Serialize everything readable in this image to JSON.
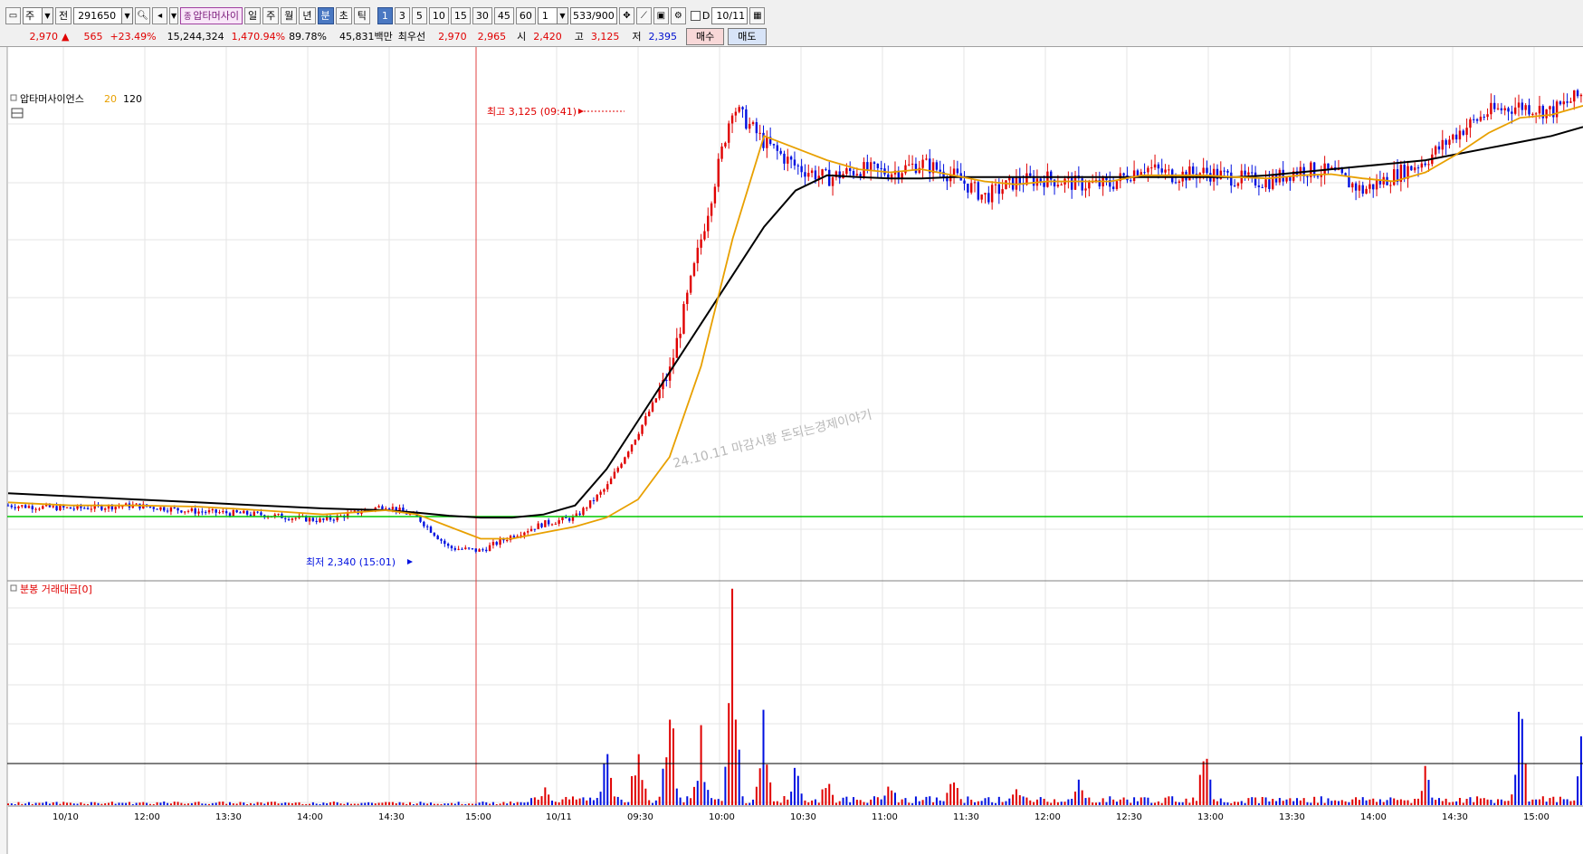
{
  "toolbar": {
    "row1": {
      "market_label": "주",
      "prefix_label": "전",
      "code": "291650",
      "stock_name": "압타머사이",
      "periods": [
        "일",
        "주",
        "월",
        "년",
        "분",
        "초",
        "틱"
      ],
      "active_period": "분",
      "intervals": [
        "1",
        "3",
        "5",
        "10",
        "15",
        "30",
        "45",
        "60"
      ],
      "active_interval": "1",
      "multiplier": "1",
      "count": "533/900",
      "d_label": "D",
      "date": "10/11"
    },
    "row2": {
      "price": "2,970",
      "change_arrow": "▲",
      "change": "565",
      "change_pct": "+23.49%",
      "volume": "15,244,324",
      "volume_ratio": "1,470.94%",
      "turnover": "89.78%",
      "amount": "45,831백만",
      "best_bid_label": "최우선",
      "best_bid": "2,970",
      "best_ask": "2,965",
      "open_label": "시",
      "open": "2,420",
      "high_label": "고",
      "high": "3,125",
      "low_label": "저",
      "low": "2,395",
      "buy_label": "매수",
      "sell_label": "매도"
    }
  },
  "price_panel": {
    "legend_name": "압타머사이언스",
    "ma_short": "20",
    "ma_long": "120",
    "high_annotation": "최고 3,125 (09:41)",
    "low_annotation": "최저 2,340 (15:01)",
    "watermark": "24.10.11 마감시황 돈되는경제이야기"
  },
  "volume_panel": {
    "legend": "분봉 거래대금[0]"
  },
  "time_axis": {
    "labels": [
      "10/10",
      "12:00",
      "13:30",
      "14:00",
      "14:30",
      "15:00",
      "10/11",
      "09:30",
      "10:00",
      "10:30",
      "11:00",
      "11:30",
      "12:00",
      "12:30",
      "13:00",
      "13:30",
      "14:00",
      "14:30",
      "15:00"
    ]
  },
  "colors": {
    "up": "#e00000",
    "down": "#0010e0",
    "ma20": "#e8a000",
    "ma120": "#000000",
    "baseline": "#00c800",
    "day_divider": "#e04040"
  },
  "chart_data": {
    "type": "candlestick",
    "timeframe": "1-minute",
    "x_labels": [
      "10/10",
      "12:00",
      "13:30",
      "14:00",
      "14:30",
      "15:00",
      "10/11",
      "09:30",
      "10:00",
      "10:30",
      "11:00",
      "11:30",
      "12:00",
      "12:30",
      "13:00",
      "13:30",
      "14:00",
      "14:30",
      "15:00"
    ],
    "price_path": {
      "x": [
        0,
        40,
        80,
        120,
        160,
        200,
        240,
        260,
        280,
        300,
        320,
        340,
        360,
        380,
        400,
        420,
        440,
        460,
        480,
        500,
        520,
        540,
        560,
        580,
        600,
        620,
        640,
        660,
        680,
        700,
        720,
        740,
        760,
        780,
        800,
        820,
        840,
        860,
        880,
        900,
        920,
        940,
        960,
        980,
        1000
      ],
      "close": [
        2420,
        2415,
        2420,
        2410,
        2405,
        2395,
        2420,
        2400,
        2350,
        2345,
        2370,
        2390,
        2400,
        2450,
        2540,
        2640,
        2860,
        3080,
        3020,
        2980,
        2960,
        2975,
        2970,
        2985,
        2965,
        2930,
        2955,
        2960,
        2950,
        2950,
        2980,
        2965,
        2970,
        2960,
        2955,
        2975,
        2970,
        2940,
        2965,
        2990,
        3035,
        3070,
        3080,
        3070,
        3100
      ]
    },
    "ma20_path": [
      2425,
      2420,
      2420,
      2418,
      2412,
      2405,
      2412,
      2405,
      2385,
      2365,
      2365,
      2375,
      2385,
      2400,
      2430,
      2500,
      2650,
      2860,
      3030,
      3010,
      2990,
      2975,
      2970,
      2975,
      2965,
      2955,
      2950,
      2955,
      2955,
      2955,
      2965,
      2965,
      2965,
      2962,
      2960,
      2965,
      2967,
      2960,
      2955,
      2970,
      3000,
      3035,
      3060,
      3065,
      3080
    ],
    "ma120_path": [
      2440,
      2435,
      2430,
      2425,
      2420,
      2415,
      2412,
      2408,
      2403,
      2400,
      2400,
      2405,
      2420,
      2480,
      2560,
      2640,
      2720,
      2800,
      2880,
      2940,
      2965,
      2962,
      2960,
      2960,
      2962,
      2962,
      2962,
      2962,
      2962,
      2962,
      2962,
      2962,
      2962,
      2962,
      2965,
      2970,
      2975,
      2980,
      2985,
      2990,
      3000,
      3010,
      3020,
      3030,
      3045
    ],
    "y_range": [
      2300,
      3150
    ],
    "baseline": 2405,
    "high": {
      "value": 3125,
      "time": "09:41"
    },
    "low": {
      "value": 2340,
      "time": "15:01"
    },
    "volume_spikes": {
      "x": [
        340,
        380,
        400,
        420,
        440,
        460,
        480,
        500,
        520,
        560,
        600,
        640,
        680,
        760,
        900,
        960,
        1000
      ],
      "value": [
        10,
        25,
        40,
        60,
        35,
        100,
        45,
        20,
        15,
        12,
        18,
        10,
        12,
        30,
        18,
        55,
        40
      ]
    }
  }
}
